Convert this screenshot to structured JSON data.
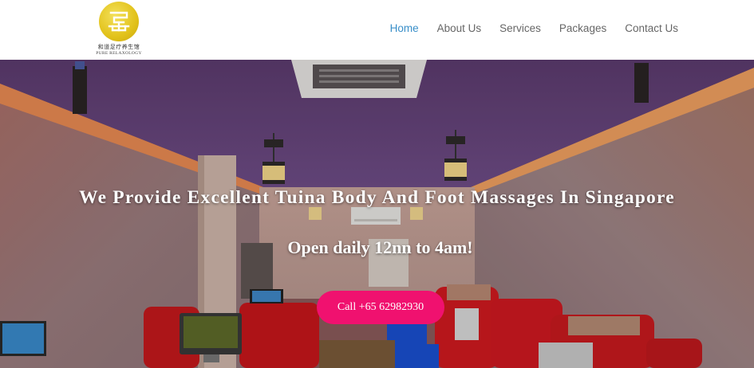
{
  "brand": {
    "chinese_name": "和道足疗养生馆",
    "english_name": "PURE RELAXOLOGY",
    "logo_color": "#e2c21a"
  },
  "nav": {
    "items": [
      {
        "label": "Home",
        "active": true
      },
      {
        "label": "About Us",
        "active": false
      },
      {
        "label": "Services",
        "active": false
      },
      {
        "label": "Packages",
        "active": false
      },
      {
        "label": "Contact Us",
        "active": false
      }
    ],
    "active_color": "#3a8fc9"
  },
  "hero": {
    "title": "We Provide Excellent Tuina Body And Foot Massages In Singapore",
    "subtitle": "Open daily 12nn to 4am!",
    "cta_label": "Call +65 62982930",
    "cta_color": "#f0116f"
  }
}
